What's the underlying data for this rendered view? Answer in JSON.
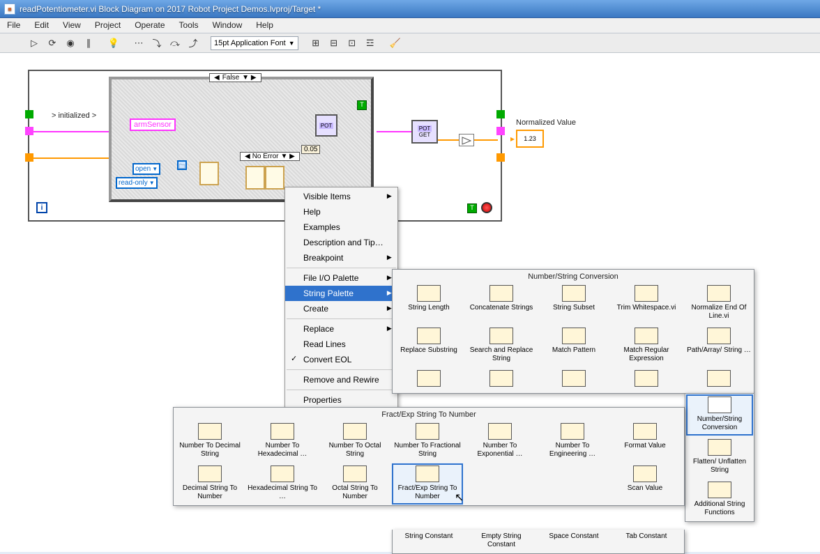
{
  "window": {
    "title": "readPotentiometer.vi Block Diagram on 2017 Robot Project Demos.lvproj/Target *"
  },
  "menus": [
    "File",
    "Edit",
    "View",
    "Project",
    "Operate",
    "Tools",
    "Window",
    "Help"
  ],
  "toolbar": {
    "font": "15pt Application Font"
  },
  "diagram": {
    "case_value": "False",
    "initialized_label": "> initialized >",
    "arm_sensor": "armSensor",
    "pot_label1": "POT",
    "pot_label2": "POT",
    "get_label": "GET",
    "no_error": "No Error",
    "open_ring": "open",
    "read_only_ring": "read-only",
    "const_005": "0.05",
    "norm_value_label": "Normalized Value",
    "indicator_text": "1.23"
  },
  "context_menu": {
    "visible_items": "Visible Items",
    "help": "Help",
    "examples": "Examples",
    "desc_tip": "Description and Tip…",
    "breakpoint": "Breakpoint",
    "fileio": "File I/O Palette",
    "string": "String Palette",
    "create": "Create",
    "replace": "Replace",
    "read_lines": "Read Lines",
    "convert_eol": "Convert EOL",
    "remove_rewire": "Remove and Rewire",
    "properties": "Properties"
  },
  "string_palette": {
    "title": "Number/String Conversion",
    "row1": [
      "String Length",
      "Concatenate Strings",
      "String Subset",
      "Trim Whitespace.vi",
      "Normalize End Of Line.vi"
    ],
    "row2": [
      "Replace Substring",
      "Search and Replace String",
      "Match Pattern",
      "Match Regular Expression",
      "Path/Array/ String …"
    ],
    "side": [
      "Number/String Conversion",
      "Flatten/ Unflatten String",
      "Additional String Functions"
    ],
    "row4": [
      "String Constant",
      "Empty String Constant",
      "Space Constant",
      "Tab Constant"
    ]
  },
  "num_palette": {
    "title": "Fract/Exp String To Number",
    "row1": [
      "Number To Decimal String",
      "Number To Hexadecimal …",
      "Number To Octal String",
      "Number To Fractional String",
      "Number To Exponential …",
      "Number To Engineering …",
      "Format Value"
    ],
    "row2": [
      "Decimal String To Number",
      "Hexadecimal String To …",
      "Octal String To Number",
      "Fract/Exp String To Number",
      "",
      "",
      "Scan Value"
    ]
  }
}
